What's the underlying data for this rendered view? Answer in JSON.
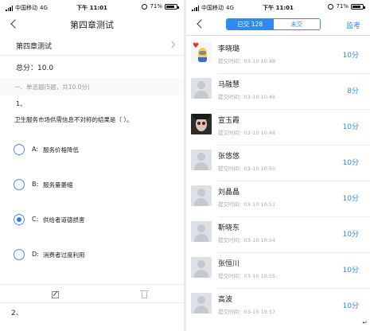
{
  "left": {
    "status": {
      "carrier": "中国移动",
      "network": "4G",
      "time": "下午 11:01",
      "battery": "71%"
    },
    "nav": {
      "title": "第四章测试"
    },
    "selector": {
      "value": "第四章测试"
    },
    "score": "总分：10.0",
    "section": "一、单选题(5题，共10.0分)",
    "question": {
      "number": "1、",
      "text": "卫生服务市场供需信息不对称的结果是（ ）。",
      "options": [
        {
          "letter": "A:",
          "text": "服务价格降低",
          "selected": false
        },
        {
          "letter": "B:",
          "text": "服务量萎缩",
          "selected": false
        },
        {
          "letter": "C:",
          "text": "供给者道德损害",
          "selected": true
        },
        {
          "letter": "D:",
          "text": "消费者过度利用",
          "selected": false
        }
      ]
    },
    "next_question": "2、"
  },
  "right": {
    "status": {
      "carrier": "中国移动",
      "network": "4G",
      "time": "下午 11:01",
      "battery": "71%"
    },
    "tabs": {
      "submitted": "已交 128",
      "not_submitted": "未交"
    },
    "monitor": "监考",
    "students": [
      {
        "name": "李晓璐",
        "time": "提交时间：03-10 10:48",
        "score": "10分",
        "avatar": "minion-avatar"
      },
      {
        "name": "马融慧",
        "time": "提交时间：03-10 10:48",
        "score": "8分",
        "avatar": "default-avatar"
      },
      {
        "name": "宣玉霞",
        "time": "提交时间：03-10 10:48",
        "score": "10分",
        "avatar": "photo-avatar"
      },
      {
        "name": "张悠悠",
        "time": "提交时间：03-10 10:50",
        "score": "10分",
        "avatar": "default-avatar"
      },
      {
        "name": "刘晶晶",
        "time": "提交时间：03-10 10:51",
        "score": "10分",
        "avatar": "default-avatar"
      },
      {
        "name": "靳晓东",
        "time": "提交时间：03-10 10:54",
        "score": "10分",
        "avatar": "default-avatar"
      },
      {
        "name": "张恒川",
        "time": "提交时间：03-10 10:55",
        "score": "10分",
        "avatar": "default-avatar"
      },
      {
        "name": "高波",
        "time": "提交时间：03-10 10:57",
        "score": "10分",
        "avatar": "default-avatar"
      }
    ],
    "enter_mark": "↵"
  },
  "colors": {
    "accent": "#2d8cf0",
    "radio": "#4a8ef0"
  }
}
